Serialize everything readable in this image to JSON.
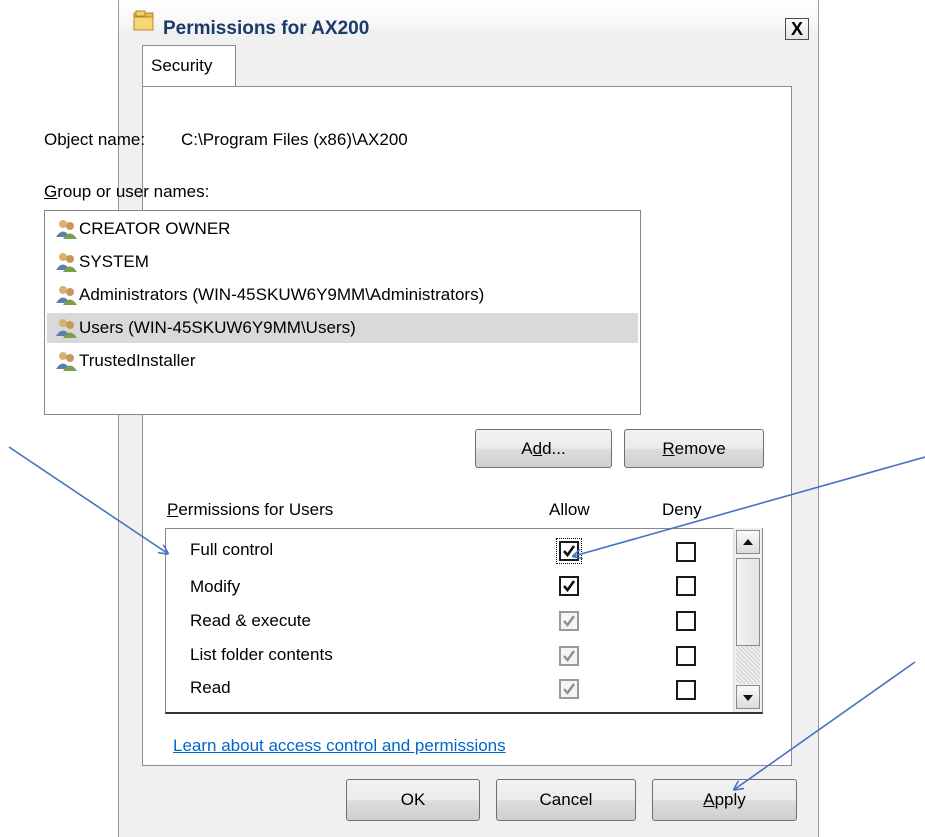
{
  "window": {
    "title": "Permissions for AX200",
    "close_glyph": "X",
    "icon": "folder-icon"
  },
  "tabs": [
    {
      "label": "Security"
    }
  ],
  "object": {
    "label": "Object name:",
    "value": "C:\\Program Files (x86)\\AX200"
  },
  "groups": {
    "label_prefix": "",
    "label_accel": "G",
    "label_rest": "roup or user names:",
    "items": [
      {
        "name": "CREATOR OWNER",
        "selected": false
      },
      {
        "name": "SYSTEM",
        "selected": false
      },
      {
        "name": "Administrators (WIN-45SKUW6Y9MM\\Administrators)",
        "selected": false
      },
      {
        "name": "Users (WIN-45SKUW6Y9MM\\Users)",
        "selected": true
      },
      {
        "name": "TrustedInstaller",
        "selected": false
      }
    ],
    "add_button": {
      "pre": "A",
      "accel": "d",
      "post": "d..."
    },
    "remove_button": {
      "pre": "",
      "accel": "R",
      "post": "emove"
    }
  },
  "permissions": {
    "label_accel": "P",
    "label_rest": "ermissions for Users",
    "allow_header": "Allow",
    "deny_header": "Deny",
    "rows": [
      {
        "name": "Full control",
        "allow": "checked",
        "deny": "unchecked"
      },
      {
        "name": "Modify",
        "allow": "checked",
        "deny": "unchecked"
      },
      {
        "name": "Read & execute",
        "allow": "inherited-checked",
        "deny": "unchecked"
      },
      {
        "name": "List folder contents",
        "allow": "inherited-checked",
        "deny": "unchecked"
      },
      {
        "name": "Read",
        "allow": "inherited-checked",
        "deny": "unchecked"
      }
    ]
  },
  "learn_link": "Learn about access control and permissions",
  "buttons": {
    "ok": "OK",
    "cancel": "Cancel",
    "apply": {
      "accel": "A",
      "rest": "pply"
    }
  },
  "colors": {
    "arrow": "#4472c4",
    "link": "#0066cc",
    "selection": "#d9d9d9"
  }
}
